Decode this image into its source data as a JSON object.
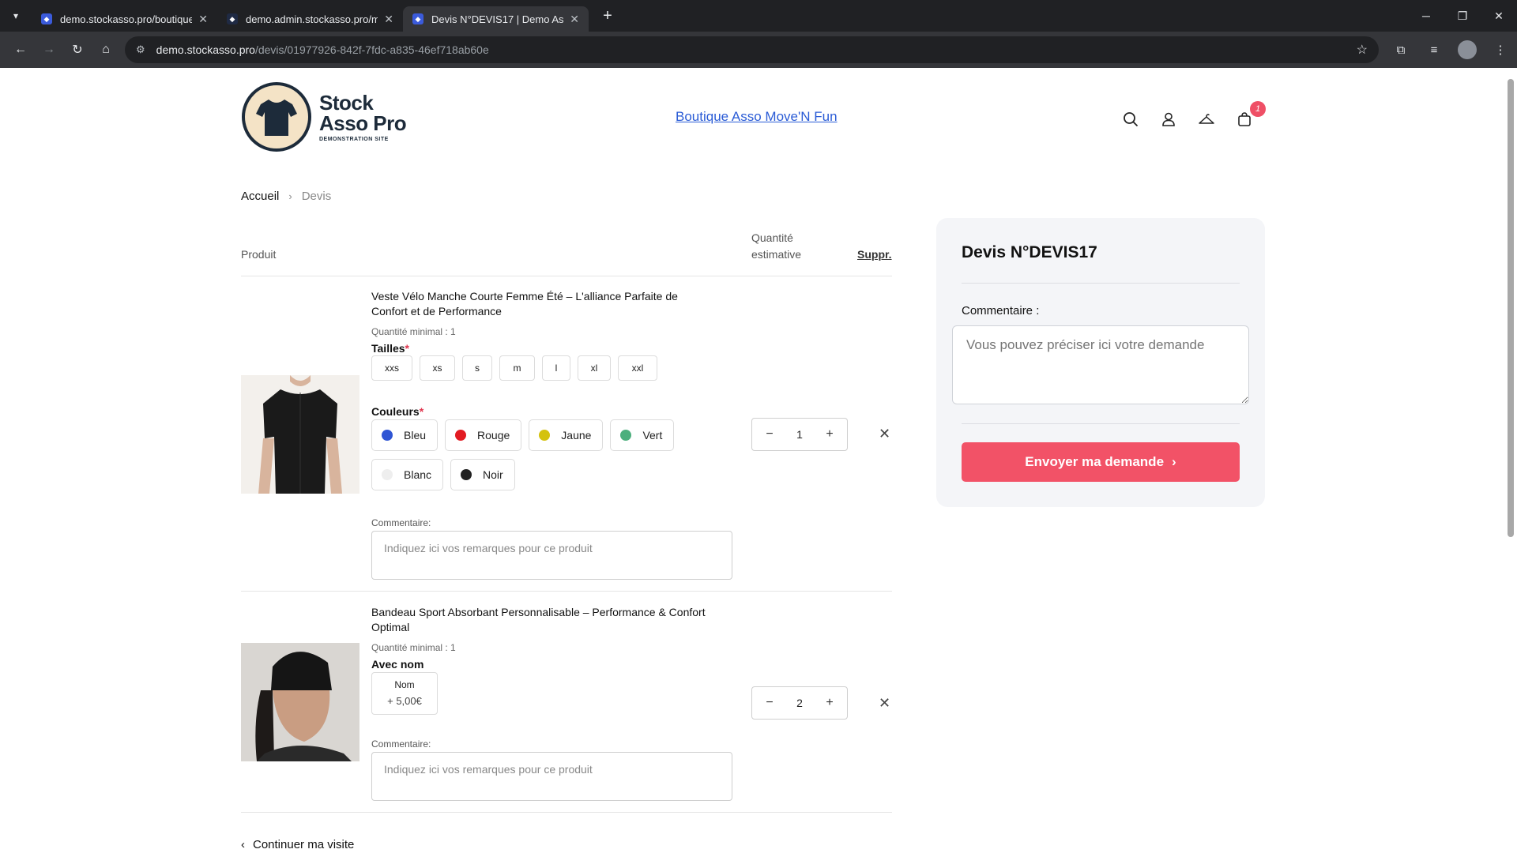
{
  "browser": {
    "tabs": [
      {
        "title": "demo.stockasso.pro/boutiques"
      },
      {
        "title": "demo.admin.stockasso.pro/men"
      },
      {
        "title": "Devis N°DEVIS17 | Demo Asso"
      }
    ],
    "url_host": "demo.stockasso.pro",
    "url_path": "/devis/01977926-842f-7fdc-a835-46ef718ab60e"
  },
  "header": {
    "logo_line1": "Stock",
    "logo_line2": "Asso Pro",
    "logo_tagline": "DEMONSTRATION SITE",
    "shop_link": "Boutique Asso Move'N Fun",
    "cart_count": "1"
  },
  "breadcrumb": {
    "home": "Accueil",
    "current": "Devis"
  },
  "table": {
    "col_product": "Produit",
    "col_qty_line1": "Quantité",
    "col_qty_line2": "estimative",
    "col_remove": "Suppr."
  },
  "products": [
    {
      "title": "Veste Vélo Manche Courte Femme Été – L'alliance Parfaite de Confort et de Performance",
      "min_qty": "Quantité minimal : 1",
      "sizes_label": "Tailles",
      "sizes": [
        "xxs",
        "xs",
        "s",
        "m",
        "l",
        "xl",
        "xxl"
      ],
      "colors_label": "Couleurs",
      "colors": [
        {
          "name": "Bleu",
          "hex": "#2f55d4"
        },
        {
          "name": "Rouge",
          "hex": "#e21b22"
        },
        {
          "name": "Jaune",
          "hex": "#d4c20e"
        },
        {
          "name": "Vert",
          "hex": "#4caf7d"
        },
        {
          "name": "Blanc",
          "hex": "#eeeeee"
        },
        {
          "name": "Noir",
          "hex": "#222222"
        }
      ],
      "comment_label": "Commentaire:",
      "comment_placeholder": "Indiquez ici vos remarques pour ce produit",
      "quantity": "1"
    },
    {
      "title": "Bandeau Sport Absorbant Personnalisable – Performance & Confort Optimal",
      "min_qty": "Quantité minimal : 1",
      "option_label": "Avec nom",
      "option_name": "Nom",
      "option_price": "+ 5,00€",
      "comment_label": "Commentaire:",
      "comment_placeholder": "Indiquez ici vos remarques pour ce produit",
      "quantity": "2"
    }
  ],
  "continue_label": "Continuer ma visite",
  "quote_panel": {
    "title": "Devis N°DEVIS17",
    "comment_label": "Commentaire :",
    "comment_placeholder": "Vous pouvez préciser ici votre demande",
    "submit_label": "Envoyer ma demande"
  }
}
